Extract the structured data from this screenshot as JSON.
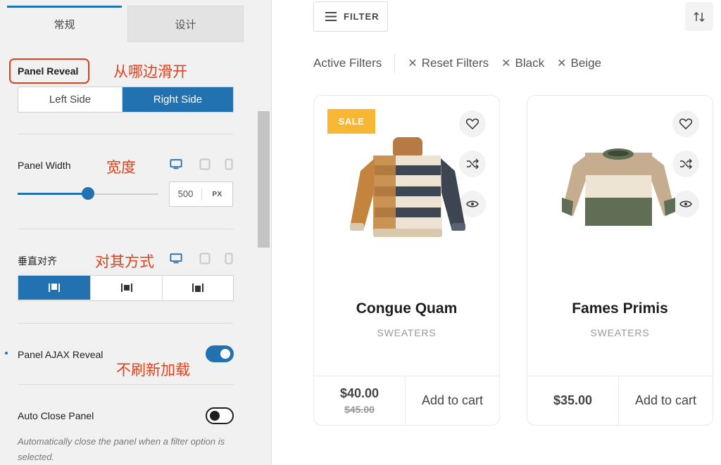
{
  "settings_panel": {
    "tabs": [
      {
        "label": "常规",
        "active": true
      },
      {
        "label": "设计",
        "active": false
      }
    ],
    "panel_reveal": {
      "label": "Panel Reveal",
      "annotation": "从哪边滑开",
      "options": [
        "Left Side",
        "Right Side"
      ],
      "selected": "Right Side"
    },
    "panel_width": {
      "label": "Panel Width",
      "annotation": "宽度",
      "value": "500",
      "unit": "PX",
      "slider_percent": 50
    },
    "vertical_align": {
      "label": "垂直对齐",
      "annotation": "对其方式",
      "selected_index": 0
    },
    "panel_ajax_reveal": {
      "label": "Panel AJAX Reveal",
      "annotation": "不刷新加载",
      "enabled": true
    },
    "auto_close_panel": {
      "label": "Auto Close Panel",
      "enabled": false,
      "description": "Automatically close the panel when a filter option is selected."
    },
    "accent_color": "#2271b1",
    "annotation_color": "#e2401b"
  },
  "shop": {
    "filter_button": "FILTER",
    "active_filters_label": "Active Filters",
    "chips": [
      "Reset Filters",
      "Black",
      "Beige"
    ],
    "products": [
      {
        "name": "Congue Quam",
        "category": "SWEATERS",
        "price": "$40.00",
        "old_price": "$45.00",
        "badge": "SALE",
        "cart": "Add to cart"
      },
      {
        "name": "Fames Primis",
        "category": "SWEATERS",
        "price": "$35.00",
        "old_price": "",
        "badge": "",
        "cart": "Add to cart"
      }
    ],
    "badge_color": "#f8b733"
  }
}
